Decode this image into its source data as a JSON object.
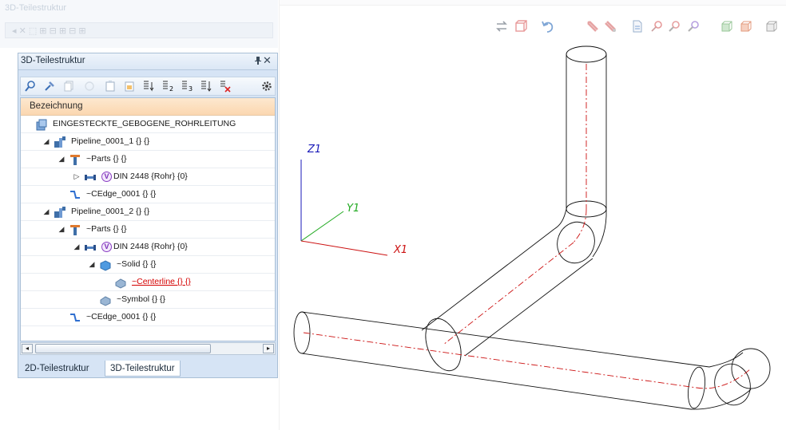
{
  "background_panel": {
    "title": "3D-Teilestruktur",
    "bar_text": "◂  ✕  ⬚   ⊞ ⊟ ⊞ ⊟ ⊞"
  },
  "toolbar_3d": {
    "icons": [
      "swap-icon",
      "box-view-icon",
      "undo-icon",
      "pencil-icon",
      "pencil-alt-icon",
      "document-icon",
      "pin-icon",
      "search-icon",
      "search-alt-icon",
      "cube-green-icon",
      "cube-orange-icon",
      "cube-wire-icon"
    ]
  },
  "panel": {
    "title": "3D-Teilestruktur",
    "pin_glyph": "📌",
    "close_glyph": "✕",
    "column_header": "Bezeichnung",
    "toolbar_icons": [
      "find-icon",
      "pick-icon",
      "copy-icon",
      "cut-icon",
      "paste-icon",
      "paste-alt-icon",
      "sort-1-icon",
      "sort-2-icon",
      "sort-3-icon",
      "sort-down-icon",
      "sort-delete-icon",
      "settings-icon"
    ],
    "tree": [
      {
        "label": "EINGESTECKTE_GEBOGENE_ROHRLEITUNG",
        "indent": 0,
        "expander": "",
        "icon": "assembly-icon"
      },
      {
        "label": "Pipeline_0001_1 {} {}",
        "indent": 1,
        "expander": "◢",
        "icon": "pipeline-icon"
      },
      {
        "label": "~Parts {} {}",
        "indent": 2,
        "expander": "◢",
        "icon": "parts-icon"
      },
      {
        "label": "DIN 2448 {Rohr} {0}",
        "indent": 3,
        "expander": "▷",
        "icon": "pipe-icon",
        "badge": "V"
      },
      {
        "label": "~CEdge_0001 {} {}",
        "indent": 2,
        "expander": "",
        "icon": "edge-icon"
      },
      {
        "label": "Pipeline_0001_2 {} {}",
        "indent": 1,
        "expander": "◢",
        "icon": "pipeline-icon"
      },
      {
        "label": "~Parts {} {}",
        "indent": 2,
        "expander": "◢",
        "icon": "parts-icon"
      },
      {
        "label": "DIN 2448 {Rohr} {0}",
        "indent": 3,
        "expander": "◢",
        "icon": "pipe-icon",
        "badge": "V"
      },
      {
        "label": "~Solid {} {}",
        "indent": 4,
        "expander": "◢",
        "icon": "solid-icon"
      },
      {
        "label": "~Centerline {} {}",
        "indent": 5,
        "expander": "",
        "icon": "centerline-icon",
        "link": true
      },
      {
        "label": "~Symbol {} {}",
        "indent": 4,
        "expander": "",
        "icon": "symbol-icon"
      },
      {
        "label": "~CEdge_0001 {} {}",
        "indent": 2,
        "expander": "",
        "icon": "edge-icon"
      }
    ],
    "scroll_left": "◂",
    "scroll_right": "▸",
    "tabs": [
      {
        "label": "2D-Teilestruktur",
        "active": false
      },
      {
        "label": "3D-Teilestruktur",
        "active": true
      }
    ]
  },
  "viewport": {
    "axes": {
      "z": "Z1",
      "y": "Y1",
      "x": "X1"
    },
    "colors": {
      "z": "#1a1ab8",
      "y": "#22aa22",
      "x": "#cc1111",
      "pipe": "#111111",
      "centerline": "#cc1111"
    }
  }
}
